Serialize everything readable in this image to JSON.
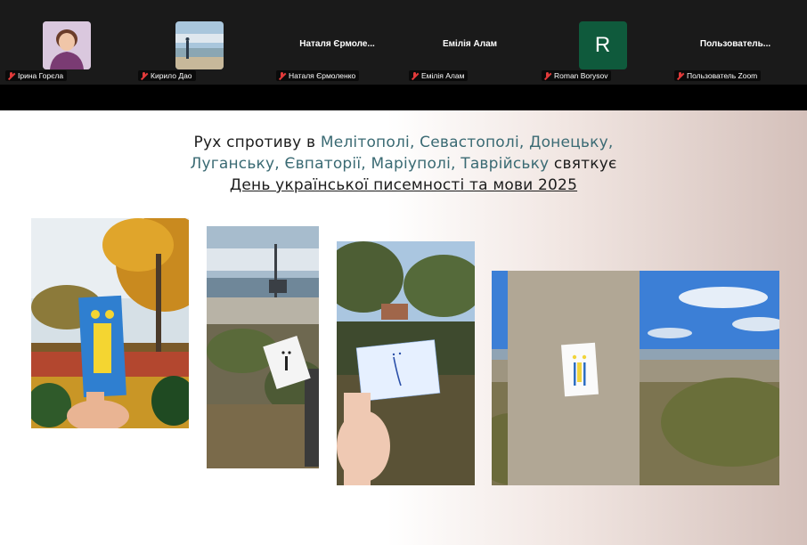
{
  "participants": [
    {
      "name": "Ірина Горєла",
      "video": "photo"
    },
    {
      "name": "Кирило Дао",
      "video": "photo"
    },
    {
      "name": "Наталя Єрмоленко",
      "display": "Наталя Єрмоле..."
    },
    {
      "name": "Емілія Алам",
      "display": "Емілія Алам"
    },
    {
      "name": "Roman Borysov",
      "avatar_letter": "R",
      "avatar_color": "#0f5a3c"
    },
    {
      "name": "Пользователь Zoom",
      "display": "Пользователь..."
    }
  ],
  "slide": {
    "line1_pre": "Рух спротиву в ",
    "line1_cities": "Мелітополі, Севастополі, Донецьку,",
    "line2_cities": "Луганську, Євпаторії, Маріуполі, Таврійську",
    "line2_post": " святкує",
    "line3": "День української писемності та мови 2025"
  },
  "colors": {
    "city_text": "#3a6a73",
    "muted_mic": "#e23a3a"
  }
}
